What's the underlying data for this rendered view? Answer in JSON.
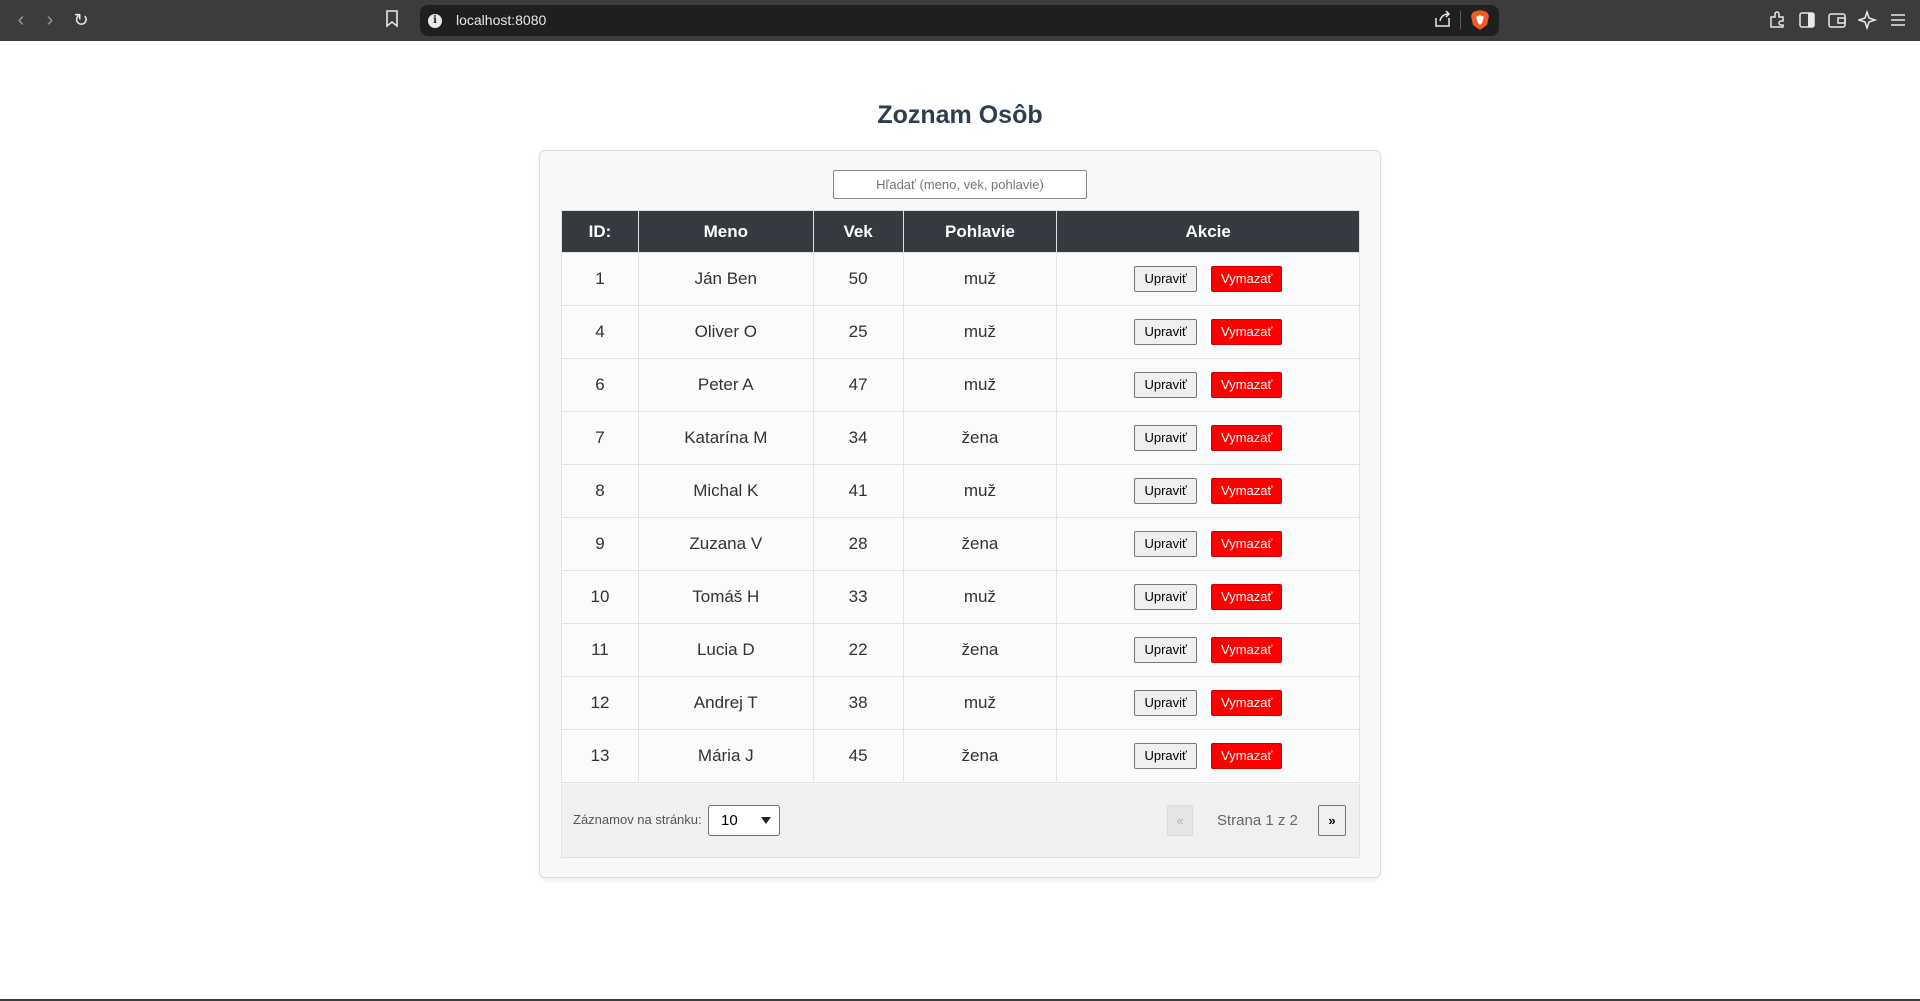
{
  "browser": {
    "url": "localhost:8080"
  },
  "page": {
    "title": "Zoznam Osôb",
    "search_placeholder": "Hľadať (meno, vek, pohlavie)"
  },
  "table": {
    "headers": {
      "id": "ID:",
      "name": "Meno",
      "age": "Vek",
      "gender": "Pohlavie",
      "actions": "Akcie"
    },
    "edit_label": "Upraviť",
    "delete_label": "Vymazať",
    "rows": [
      {
        "id": "1",
        "name": "Ján Ben",
        "age": "50",
        "gender": "muž"
      },
      {
        "id": "4",
        "name": "Oliver O",
        "age": "25",
        "gender": "muž"
      },
      {
        "id": "6",
        "name": "Peter A",
        "age": "47",
        "gender": "muž"
      },
      {
        "id": "7",
        "name": "Katarína M",
        "age": "34",
        "gender": "žena"
      },
      {
        "id": "8",
        "name": "Michal K",
        "age": "41",
        "gender": "muž"
      },
      {
        "id": "9",
        "name": "Zuzana V",
        "age": "28",
        "gender": "žena"
      },
      {
        "id": "10",
        "name": "Tomáš H",
        "age": "33",
        "gender": "muž"
      },
      {
        "id": "11",
        "name": "Lucia D",
        "age": "22",
        "gender": "žena"
      },
      {
        "id": "12",
        "name": "Andrej T",
        "age": "38",
        "gender": "muž"
      },
      {
        "id": "13",
        "name": "Mária J",
        "age": "45",
        "gender": "žena"
      }
    ]
  },
  "pagination": {
    "per_page_label": "Záznamov na stránku:",
    "per_page_value": "10",
    "prev_label": "«",
    "next_label": "»",
    "page_info": "Strana 1 z 2"
  },
  "colors": {
    "header_bg": "#343a40",
    "delete_bg": "#ff0000",
    "title": "#2c3e50"
  }
}
